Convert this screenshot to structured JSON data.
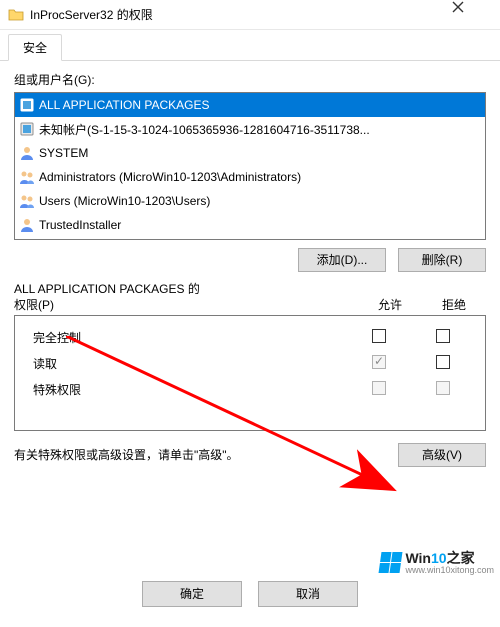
{
  "window": {
    "title": "InProcServer32 的权限",
    "close_icon": "close-icon"
  },
  "tabs": {
    "security": "安全"
  },
  "groups_label": "组或用户名(G):",
  "principals": [
    {
      "name": "ALL APPLICATION PACKAGES",
      "icon": "package",
      "selected": true
    },
    {
      "name": "未知帐户(S-1-15-3-1024-1065365936-1281604716-3511738...",
      "icon": "package",
      "selected": false
    },
    {
      "name": "SYSTEM",
      "icon": "user",
      "selected": false
    },
    {
      "name": "Administrators (MicroWin10-1203\\Administrators)",
      "icon": "group",
      "selected": false
    },
    {
      "name": "Users (MicroWin10-1203\\Users)",
      "icon": "group",
      "selected": false
    },
    {
      "name": "TrustedInstaller",
      "icon": "user",
      "selected": false
    }
  ],
  "buttons": {
    "add": "添加(D)...",
    "remove": "删除(R)",
    "advanced": "高级(V)",
    "ok": "确定",
    "cancel": "取消"
  },
  "perm_header": {
    "label_line1": "ALL APPLICATION PACKAGES 的",
    "label_line2": "权限(P)",
    "allow": "允许",
    "deny": "拒绝"
  },
  "permissions": [
    {
      "name": "完全控制",
      "allow": false,
      "deny": false,
      "disabled": false
    },
    {
      "name": "读取",
      "allow": true,
      "deny": false,
      "disabled": true
    },
    {
      "name": "特殊权限",
      "allow": false,
      "deny": false,
      "disabled": true
    }
  ],
  "advanced_hint": "有关特殊权限或高级设置，请单击\"高级\"。",
  "watermark": {
    "brand_prefix": "Win",
    "brand_num": "10",
    "brand_suffix": "之家",
    "url": "www.win10xitong.com"
  }
}
